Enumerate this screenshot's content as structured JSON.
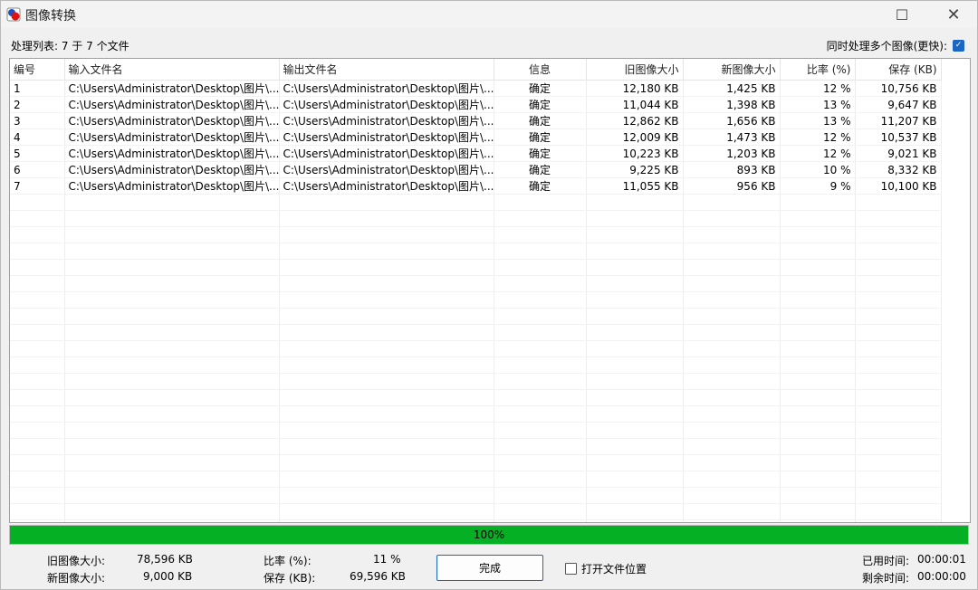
{
  "window": {
    "title": "图像转换",
    "maximize_glyph": "☐",
    "close_glyph": "✕"
  },
  "header": {
    "process_list_label": "处理列表: 7 于 7 个文件",
    "multi_label": "同时处理多个图像(更快):",
    "multi_checked": true
  },
  "table": {
    "columns": [
      "编号",
      "输入文件名",
      "输出文件名",
      "信息",
      "旧图像大小",
      "新图像大小",
      "比率 (%)",
      "保存 (KB)"
    ],
    "rows": [
      {
        "no": "1",
        "input": "C:\\Users\\Administrator\\Desktop\\图片\\...",
        "output": "C:\\Users\\Administrator\\Desktop\\图片\\...",
        "info": "确定",
        "old": "12,180 KB",
        "new": "1,425 KB",
        "ratio": "12 %",
        "saved": "10,756 KB"
      },
      {
        "no": "2",
        "input": "C:\\Users\\Administrator\\Desktop\\图片\\...",
        "output": "C:\\Users\\Administrator\\Desktop\\图片\\...",
        "info": "确定",
        "old": "11,044 KB",
        "new": "1,398 KB",
        "ratio": "13 %",
        "saved": "9,647 KB"
      },
      {
        "no": "3",
        "input": "C:\\Users\\Administrator\\Desktop\\图片\\...",
        "output": "C:\\Users\\Administrator\\Desktop\\图片\\...",
        "info": "确定",
        "old": "12,862 KB",
        "new": "1,656 KB",
        "ratio": "13 %",
        "saved": "11,207 KB"
      },
      {
        "no": "4",
        "input": "C:\\Users\\Administrator\\Desktop\\图片\\...",
        "output": "C:\\Users\\Administrator\\Desktop\\图片\\...",
        "info": "确定",
        "old": "12,009 KB",
        "new": "1,473 KB",
        "ratio": "12 %",
        "saved": "10,537 KB"
      },
      {
        "no": "5",
        "input": "C:\\Users\\Administrator\\Desktop\\图片\\...",
        "output": "C:\\Users\\Administrator\\Desktop\\图片\\...",
        "info": "确定",
        "old": "10,223 KB",
        "new": "1,203 KB",
        "ratio": "12 %",
        "saved": "9,021 KB"
      },
      {
        "no": "6",
        "input": "C:\\Users\\Administrator\\Desktop\\图片\\...",
        "output": "C:\\Users\\Administrator\\Desktop\\图片\\...",
        "info": "确定",
        "old": "9,225 KB",
        "new": "893 KB",
        "ratio": "10 %",
        "saved": "8,332 KB"
      },
      {
        "no": "7",
        "input": "C:\\Users\\Administrator\\Desktop\\图片\\...",
        "output": "C:\\Users\\Administrator\\Desktop\\图片\\...",
        "info": "确定",
        "old": "11,055 KB",
        "new": "956 KB",
        "ratio": "9 %",
        "saved": "10,100 KB"
      }
    ]
  },
  "progress": {
    "fraction": 1.0,
    "label": "100%",
    "color": "#06b025"
  },
  "summary": {
    "old_label": "旧图像大小:",
    "old_value": "78,596 KB",
    "new_label": "新图像大小:",
    "new_value": "9,000 KB",
    "ratio_label": "比率 (%):",
    "ratio_value": "11 %",
    "saved_label": "保存 (KB):",
    "saved_value": "69,596 KB",
    "elapsed_label": "已用时间:",
    "elapsed_value": "00:00:01",
    "remaining_label": "剩余时间:",
    "remaining_value": "00:00:00"
  },
  "actions": {
    "done_label": "完成",
    "open_location_label": "打开文件位置",
    "open_location_checked": false
  },
  "colors": {
    "accent": "#1a66c5"
  }
}
